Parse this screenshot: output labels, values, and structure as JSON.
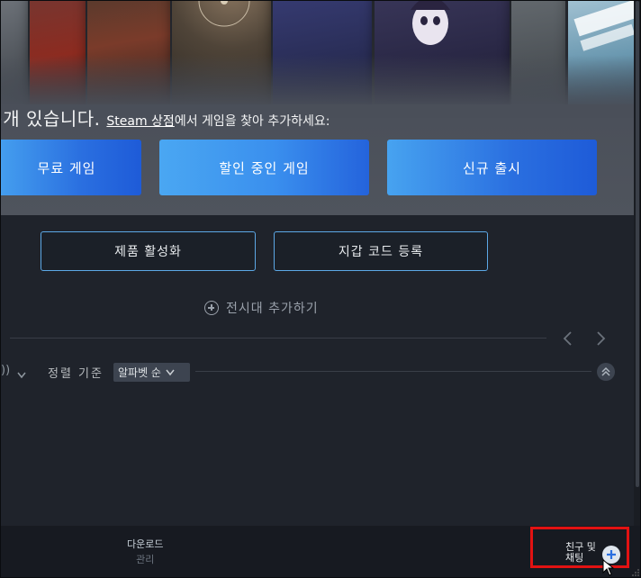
{
  "hero": {
    "message_prefix": ")개 있습니다.",
    "store_link": "Steam 상점",
    "message_suffix": "에서 게임을 찾아 추가하세요:",
    "buttons": [
      "무료 게임",
      "할인 중인 게임",
      "신규 출시"
    ]
  },
  "actions": {
    "activate_product": "제품 활성화",
    "redeem_wallet": "지갑 코드 등록",
    "add_shelf": "전시대 추가하기"
  },
  "filter": {
    "cut_text": "))",
    "sort_label": "정렬 기준",
    "sort_value": "알파벳 순"
  },
  "bottombar": {
    "downloads_title": "다운로드",
    "downloads_sub": "관리",
    "friends_line1": "친구 및",
    "friends_line2": "채팅"
  },
  "colors": {
    "accent_blue": "#2a6fe0",
    "highlight_red": "#e21212"
  }
}
